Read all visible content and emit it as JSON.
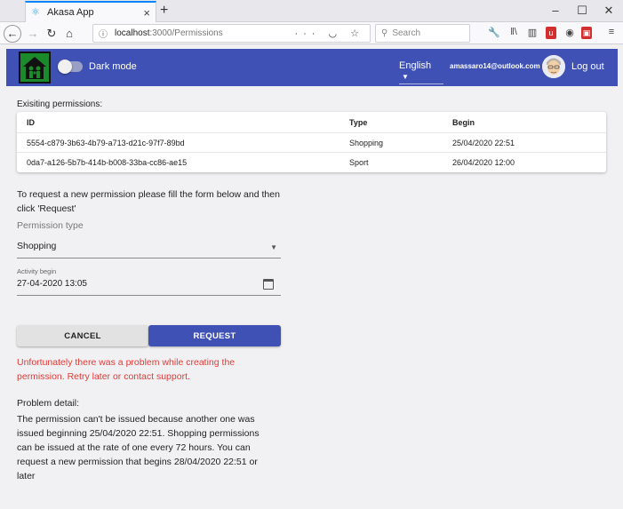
{
  "browser": {
    "tab_title": "Akasa App",
    "url_host": "localhost",
    "url_path": ":3000/Permissions",
    "search_placeholder": "Search"
  },
  "header": {
    "dark_mode_label": "Dark mode",
    "language": "English",
    "user_email": "amassaro14@outlook.com",
    "logout_label": "Log out",
    "brand_color": "#3f51b5"
  },
  "permissions": {
    "title": "Exisiting permissions:",
    "columns": [
      "ID",
      "Type",
      "Begin"
    ],
    "rows": [
      {
        "id": "5554-c879-3b63-4b79-a713-d21c-97f7-89bd",
        "type": "Shopping",
        "begin": "25/04/2020 22:51"
      },
      {
        "id": "0da7-a126-5b7b-414b-b008-33ba-cc86-ae15",
        "type": "Sport",
        "begin": "26/04/2020 12:00"
      }
    ]
  },
  "form": {
    "intro": "To request a new permission please fill the form below and then click 'Request'",
    "permission_type_label": "Permission type",
    "permission_type_value": "Shopping",
    "activity_begin_label": "Activity begin",
    "activity_begin_value": "27-04-2020 13:05",
    "cancel_label": "CANCEL",
    "request_label": "REQUEST"
  },
  "error": {
    "message": "Unfortunately there was a problem while creating the permission. Retry later or contact support.",
    "detail_title": "Problem detail:",
    "detail_text": "The permission can't be issued because another one was issued beginning 25/04/2020 22:51. Shopping permissions can be issued at the rate of one every 72 hours. You can request a new permission that begins 28/04/2020 22:51 or later",
    "color": "#e53935"
  }
}
